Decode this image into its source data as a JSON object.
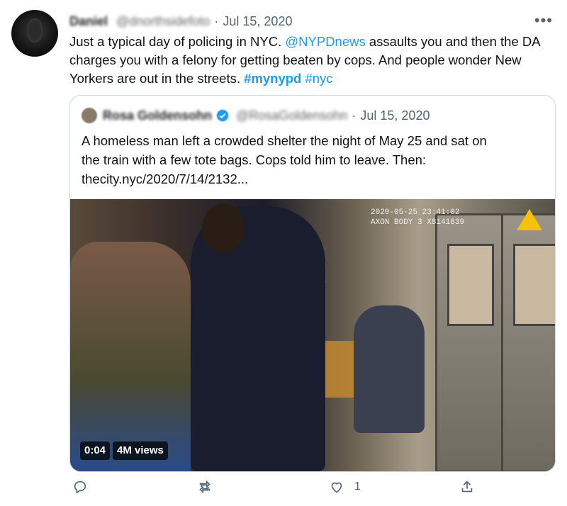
{
  "tweet": {
    "author_name": "Daniel",
    "author_handle": "@dnorthsidefoto",
    "date": "Jul 15, 2020",
    "text_parts": [
      {
        "text": "Just a typical day of policing in NYC. ",
        "kind": "plain"
      },
      {
        "text": "@NYPDnews",
        "kind": "link"
      },
      {
        "text": " assaults you and then the DA charges you with a felony for getting beaten by cops. And people wonder New Yorkers are out in the streets. ",
        "kind": "plain"
      },
      {
        "text": "#mynypd",
        "kind": "tag-bold"
      },
      {
        "text": " ",
        "kind": "plain"
      },
      {
        "text": "#nyc",
        "kind": "link"
      }
    ],
    "more_label": "•••"
  },
  "quote": {
    "author_name": "Rosa Goldensohn",
    "author_handle": "@RosaGoldensohn",
    "date": "Jul 15, 2020",
    "text_line1": "A homeless man left a crowded shelter the night of May 25 and sat on",
    "text_line2": "the train with a few tote bags. Cops told him to leave. Then:",
    "text_line3": "thecity.nyc/2020/7/14/2132...",
    "video": {
      "timestamp_line1": "2020-05-25  23:41:02",
      "timestamp_line2": "AXON BODY 3 X8141839",
      "duration": "0:04",
      "views": "4M views"
    }
  },
  "actions": {
    "reply_count": "",
    "retweet_count": "",
    "like_count": "1",
    "icons": [
      "reply-icon",
      "retweet-icon",
      "like-icon",
      "share-icon"
    ]
  },
  "colors": {
    "link": "#1d9bf0",
    "muted": "#536471",
    "border": "#cfd9de"
  }
}
